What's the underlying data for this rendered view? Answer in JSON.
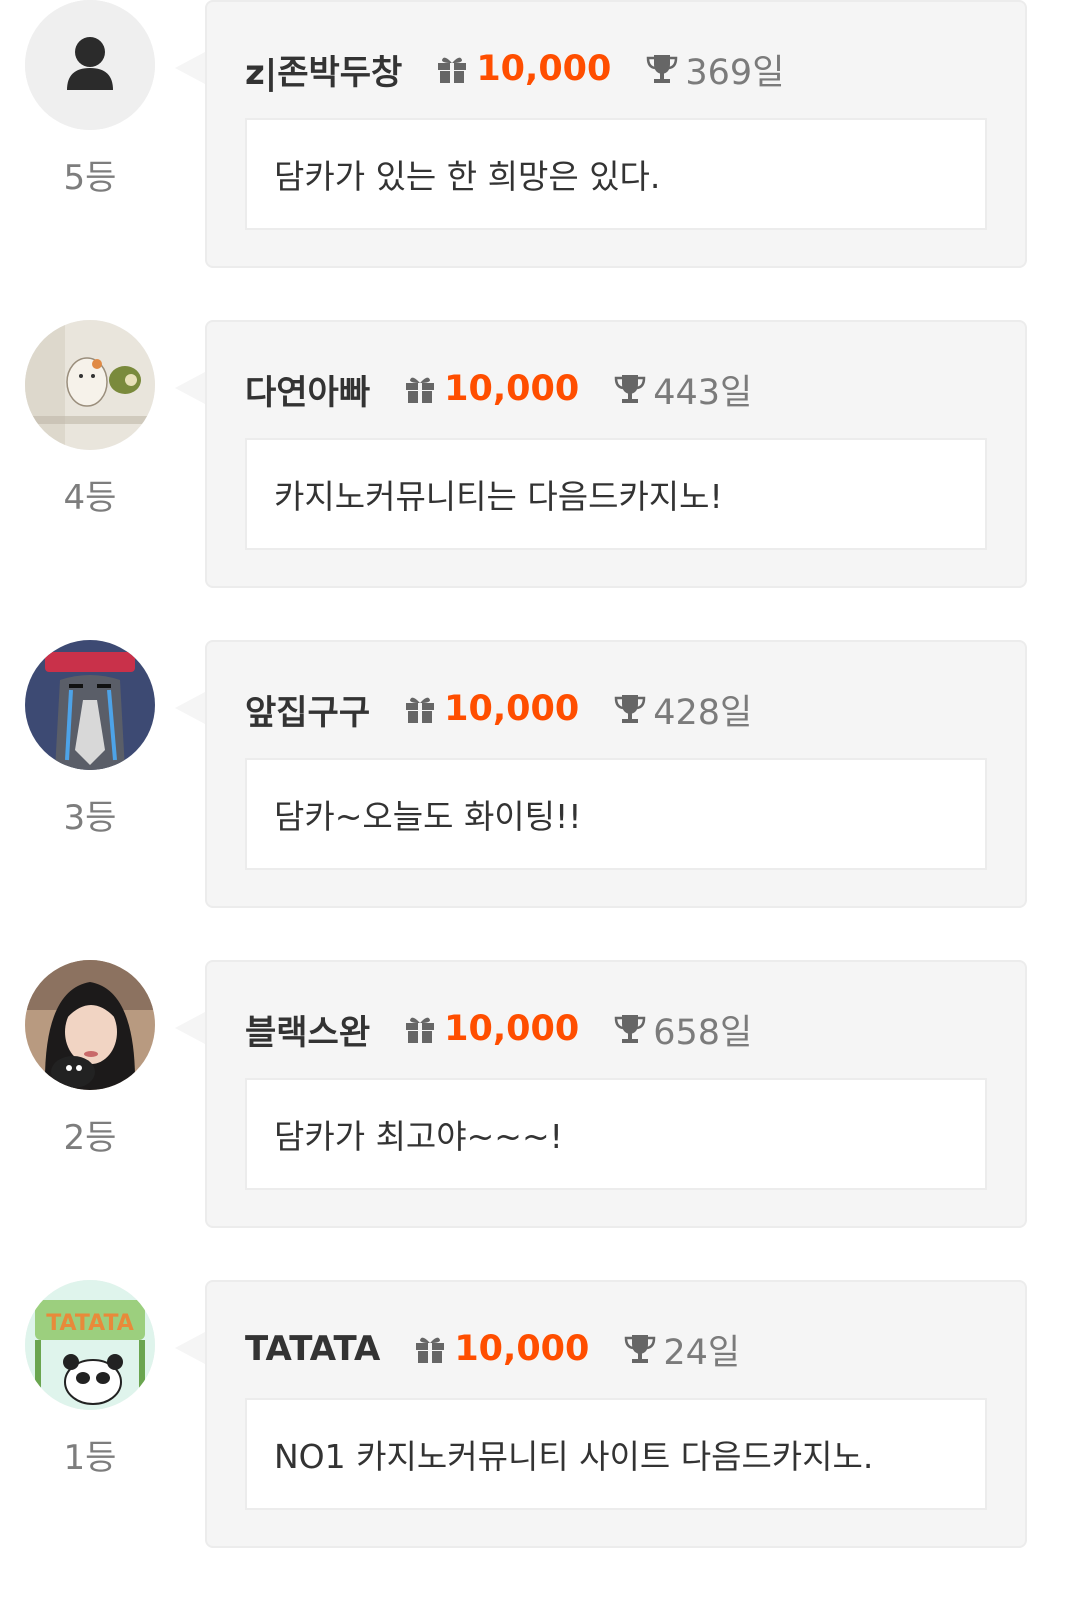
{
  "colors": {
    "points": "#ff4e00",
    "card_bg": "#f5f5f5",
    "text": "#333333",
    "muted": "#7b7b7b"
  },
  "icons": {
    "points": "gift-icon",
    "days": "trophy-icon",
    "default_avatar": "user-icon"
  },
  "entries": [
    {
      "rank": "5등",
      "nickname": "z|존박두창",
      "points": "10,000",
      "days": "369일",
      "message": "담카가 있는 한 희망은 있다."
    },
    {
      "rank": "4등",
      "nickname": "다연아빠",
      "points": "10,000",
      "days": "443일",
      "message": "카지노커뮤니티는 다음드카지노!"
    },
    {
      "rank": "3등",
      "nickname": "앞집구구",
      "points": "10,000",
      "days": "428일",
      "message": "담카~오늘도 화이팅!!"
    },
    {
      "rank": "2등",
      "nickname": "블랙스완",
      "points": "10,000",
      "days": "658일",
      "message": "담카가 최고야~~~!"
    },
    {
      "rank": "1등",
      "nickname": "TATATA",
      "points": "10,000",
      "days": "24일",
      "message": "NO1 카지노커뮤니티 사이트 다음드카지노."
    }
  ]
}
